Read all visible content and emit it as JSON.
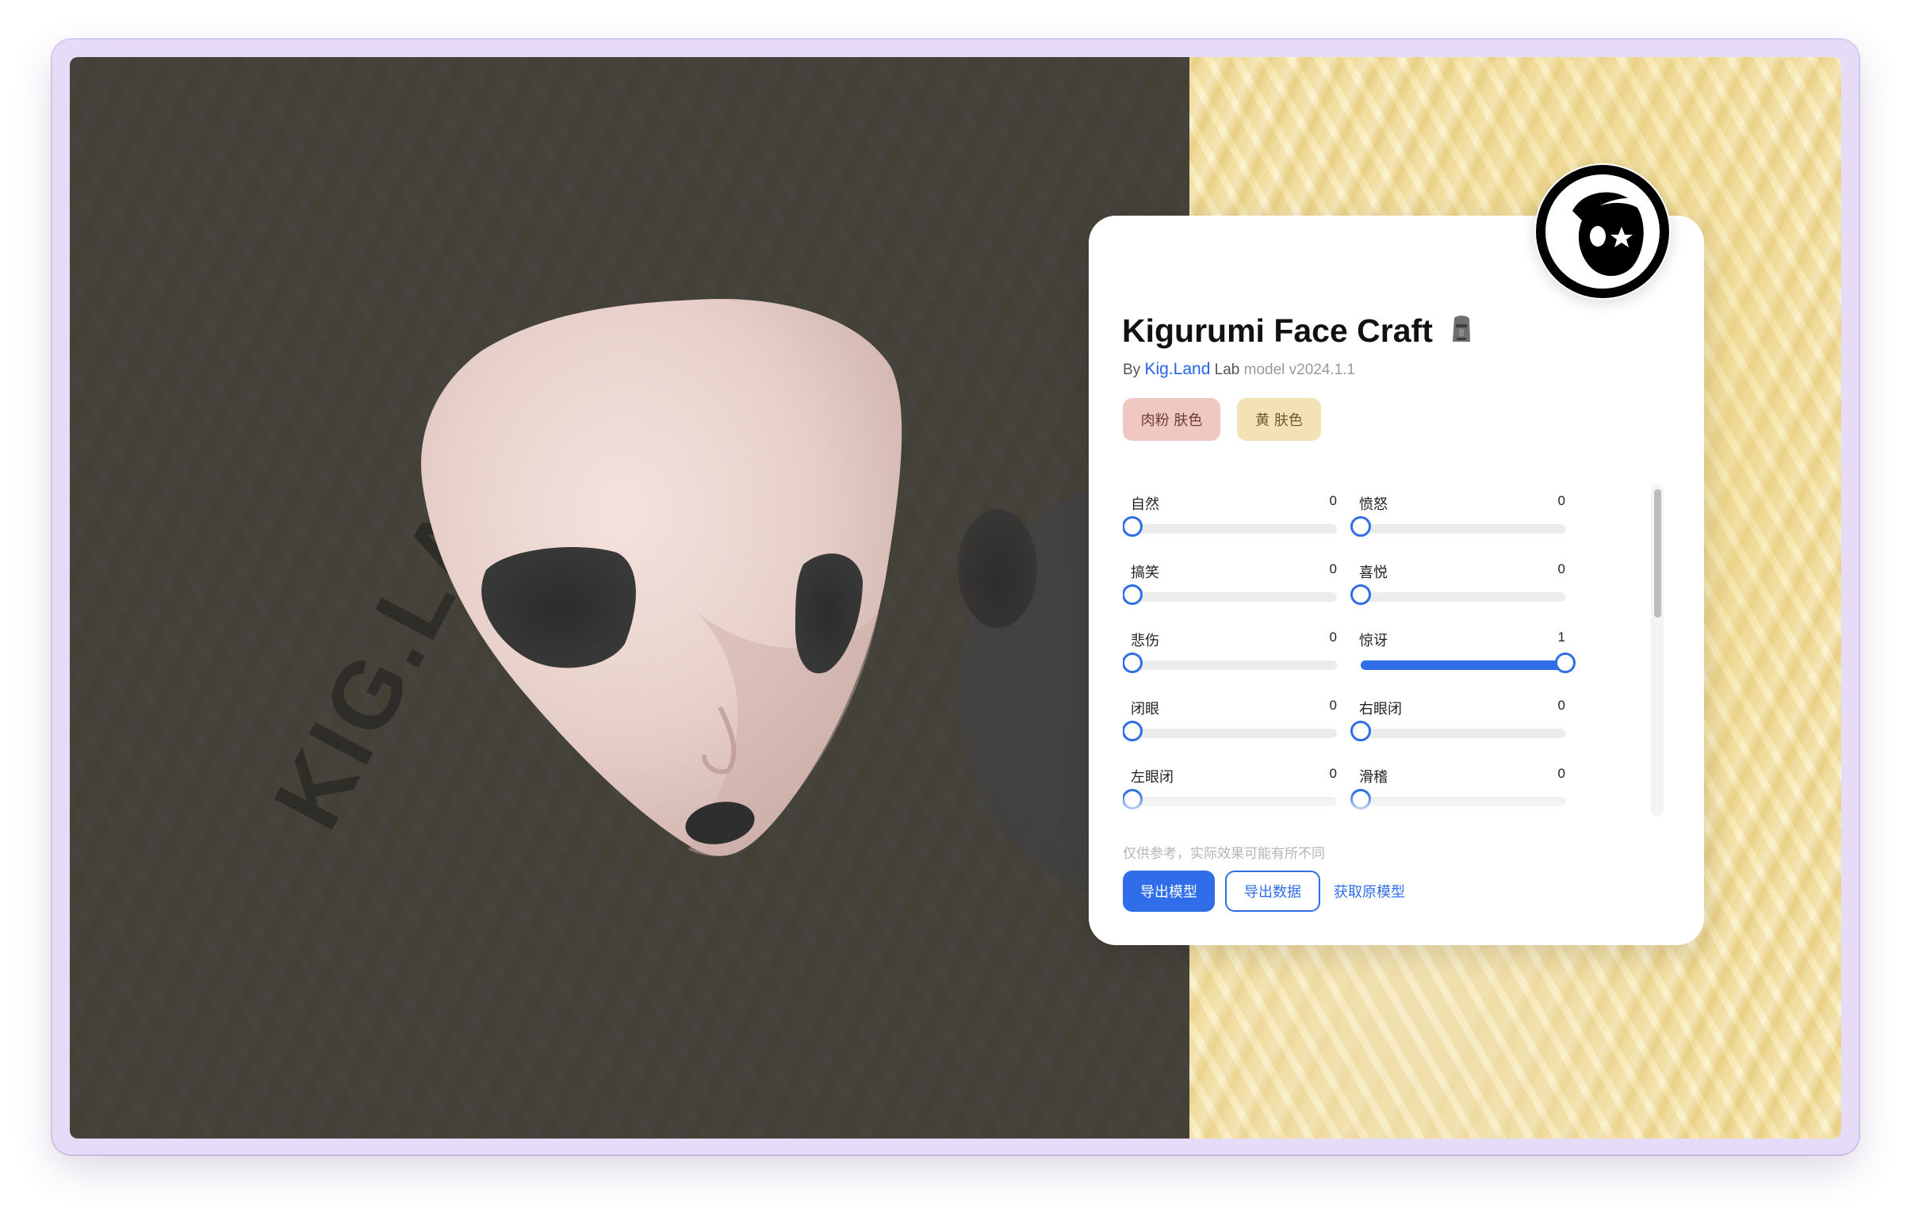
{
  "app": {
    "title": "Kigurumi Face Craft",
    "byline_prefix": "By",
    "byline_link": "Kig.Land",
    "byline_lab": "Lab",
    "byline_version": "model v2024.1.1"
  },
  "background": {
    "watermark_text": "KIG.LAND"
  },
  "skin_buttons": [
    {
      "label": "肉粉 肤色",
      "color": "#f0c8c3"
    },
    {
      "label": "黄 肤色",
      "color": "#f3e2b5"
    }
  ],
  "sliders": [
    {
      "label": "自然",
      "value": 0,
      "max": 1
    },
    {
      "label": "愤怒",
      "value": 0,
      "max": 1
    },
    {
      "label": "搞笑",
      "value": 0,
      "max": 1
    },
    {
      "label": "喜悦",
      "value": 0,
      "max": 1
    },
    {
      "label": "悲伤",
      "value": 0,
      "max": 1
    },
    {
      "label": "惊讶",
      "value": 1,
      "max": 1
    },
    {
      "label": "闭眼",
      "value": 0,
      "max": 1
    },
    {
      "label": "右眼闭",
      "value": 0,
      "max": 1
    },
    {
      "label": "左眼闭",
      "value": 0,
      "max": 1
    },
    {
      "label": "滑稽",
      "value": 0,
      "max": 1
    }
  ],
  "footer": {
    "note": "仅供参考，实际效果可能有所不同",
    "export_model": "导出模型",
    "export_data": "导出数据",
    "get_original": "获取原模型"
  },
  "colors": {
    "accent": "#2f6ee8",
    "frame": "#e6dcf8",
    "mask": "#ead4cf"
  }
}
